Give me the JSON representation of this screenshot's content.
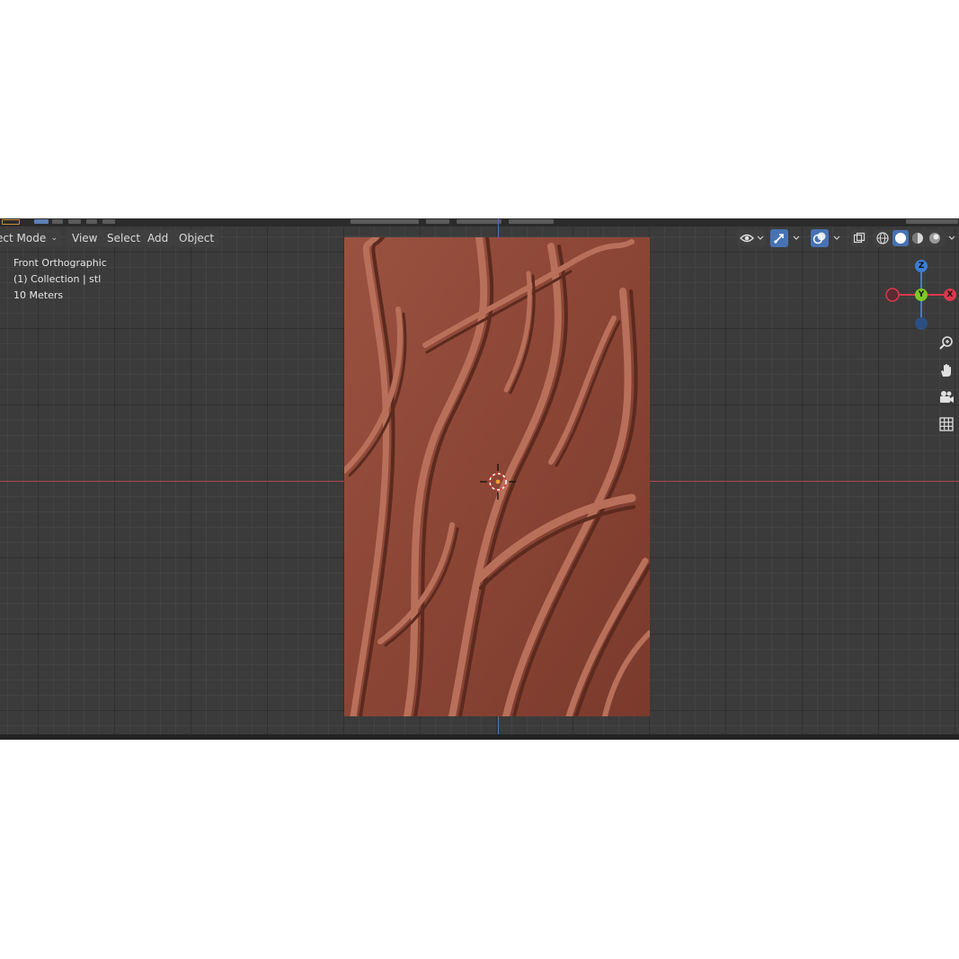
{
  "header": {
    "mode_label": "ect Mode",
    "menu": [
      {
        "label": "View"
      },
      {
        "label": "Select"
      },
      {
        "label": "Add"
      },
      {
        "label": "Object"
      }
    ]
  },
  "overlay": {
    "view_name": "Front Orthographic",
    "collection": "(1) Collection | stl",
    "scale": "10 Meters"
  },
  "gizmo": {
    "z_label": "Z",
    "y_label": "Y",
    "x_label": "X",
    "colors": {
      "x": "#d9384d",
      "y": "#7ec826",
      "z": "#3b7ed6"
    }
  },
  "object": {
    "material_color": "#8a4636"
  },
  "icons": {
    "visibility": "eye-icon",
    "gizmo_toggle": "gizmo-arrow-icon",
    "overlays": "overlay-circles-icon",
    "xray": "xray-icon",
    "shading": [
      "wireframe-shading-icon",
      "solid-shading-icon",
      "material-shading-icon",
      "rendered-shading-icon"
    ],
    "navigation": [
      "zoom-icon",
      "hand-pan-icon",
      "camera-icon",
      "grid-ortho-icon"
    ]
  }
}
